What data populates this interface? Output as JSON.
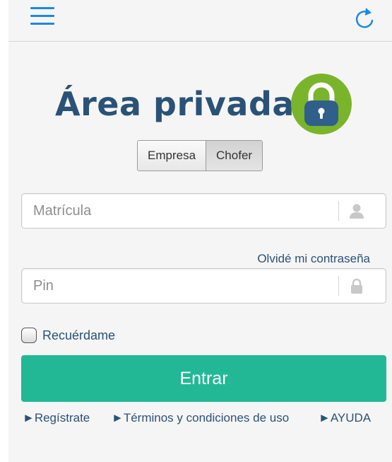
{
  "header": {
    "menu_icon": "hamburger-menu-icon",
    "refresh_icon": "refresh-icon"
  },
  "title": {
    "text": "Área privada",
    "lock_icon": "lock-icon",
    "colors": {
      "text": "#2a5276",
      "lock_ring": "#7ab42a",
      "lock_body": "#2f5f8a"
    }
  },
  "user_type": {
    "options": [
      "Empresa",
      "Chofer"
    ],
    "selected": "Chofer"
  },
  "form": {
    "plate": {
      "placeholder": "Matrícula",
      "value": "",
      "icon": "user-icon"
    },
    "forgot_password": "Olvidé mi contraseña",
    "pin": {
      "placeholder": "Pin",
      "value": "",
      "icon": "lock-small-icon"
    },
    "remember_me": {
      "label": "Recuérdame",
      "checked": false
    },
    "submit_label": "Entrar",
    "submit_color": "#22b896"
  },
  "footer_links": {
    "register": "►Regístrate",
    "terms": "►Términos y condiciones de uso",
    "help": "►AYUDA"
  }
}
